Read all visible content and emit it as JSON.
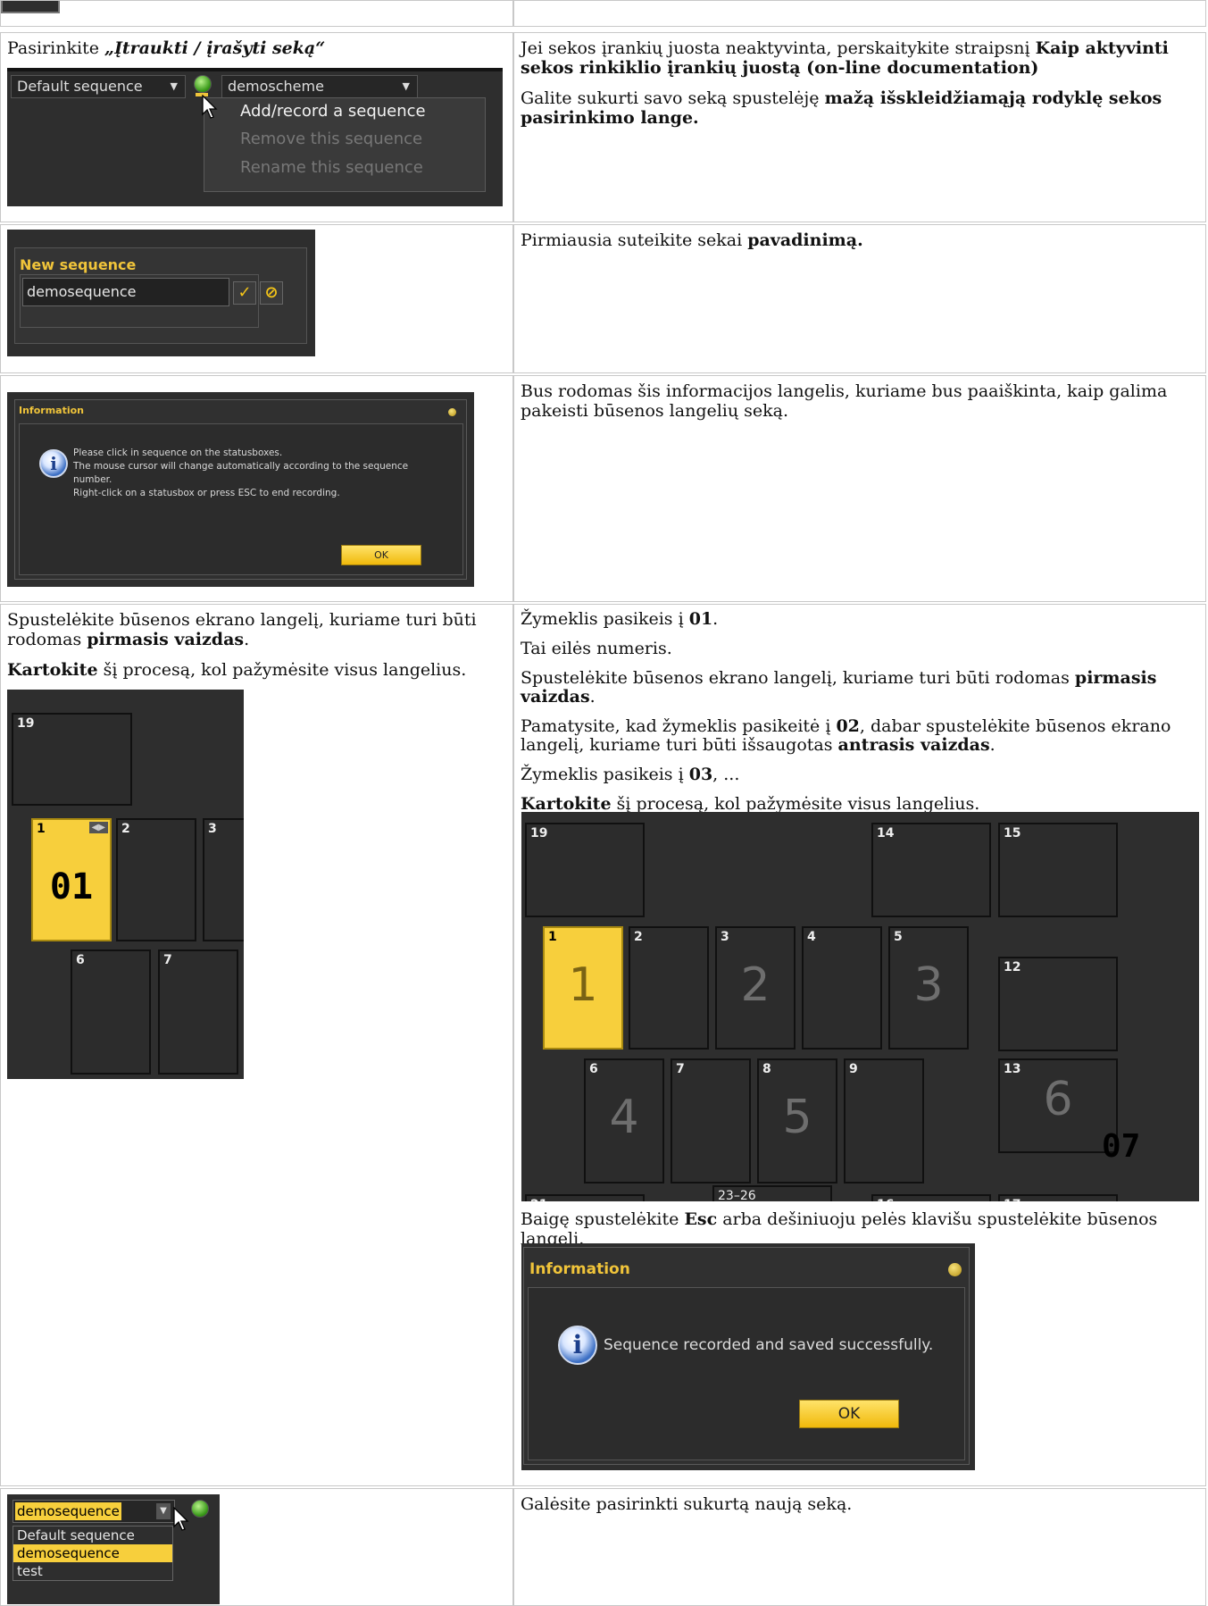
{
  "row1": {
    "left_text_prefix": "Pasirinkite ",
    "left_text_bold": "„Įtraukti / įrašyti seką“",
    "right_p1_prefix": "Jei sekos įrankių juosta neaktyvinta, perskaitykite straipsnį ",
    "right_p1_bold": "Kaip aktyvinti sekos rinkiklio įrankių juostą (on-line documentation)",
    "right_p2_prefix": "Galite sukurti savo seką spustelėję ",
    "right_p2_bold": "mažą išskleidžiamąją rodyklę sekos pasirinkimo lange.",
    "ui": {
      "sequence_dropdown": "Default sequence",
      "scheme_dropdown": "demoscheme",
      "menu_items": [
        "Add/record a sequence",
        "Remove this sequence",
        "Rename this sequence"
      ]
    }
  },
  "row2": {
    "right_prefix": "Pirmiausia suteikite sekai ",
    "right_bold": "pavadinimą.",
    "ui": {
      "title": "New sequence",
      "input_value": "demosequence"
    }
  },
  "row3": {
    "right_text": "Bus rodomas šis informacijos langelis, kuriame bus paaiškinta, kaip galima pakeisti būsenos langelių seką.",
    "ui": {
      "title": "Information",
      "lines": [
        "Please click in sequence on the statusboxes.",
        "The mouse cursor will change automatically according to the sequence",
        "number.",
        "Right-click on a statusbox or press ESC to end recording."
      ],
      "ok": "OK"
    }
  },
  "row4": {
    "left_p1_prefix": "Spustelėkite būsenos ekrano langelį, kuriame turi būti rodomas ",
    "left_p1_bold": "pirmasis vaizdas",
    "left_p1_suffix": ".",
    "left_p2_bold": "Kartokite",
    "left_p2_suffix": " šį procesą, kol pažymėsite visus langelius.",
    "left_ui": {
      "boxes": [
        "19",
        "1",
        "2",
        "3",
        "6",
        "7"
      ],
      "cursor_label": "01"
    },
    "right_p1_prefix": "Žymeklis pasikeis į ",
    "right_p1_bold": "01",
    "right_p1_suffix": ".",
    "right_p2": "Tai eilės numeris.",
    "right_p3_prefix": "Spustelėkite būsenos ekrano langelį, kuriame turi būti rodomas ",
    "right_p3_bold": "pirmasis vaizdas",
    "right_p3_suffix": ".",
    "right_p4_prefix": "Pamatysite, kad žymeklis pasikeitė į ",
    "right_p4_bold1": "02",
    "right_p4_mid": ", dabar spustelėkite būsenos ekrano langelį, kuriame turi būti išsaugotas ",
    "right_p4_bold2": "antrasis vaizdas",
    "right_p4_suffix": ".",
    "right_p5_prefix": "Žymeklis pasikeis į ",
    "right_p5_bold": "03",
    "right_p5_suffix": ", ...",
    "right_p6_bold": "Kartokite",
    "right_p6_suffix": " šį procesą, kol pažymėsite visus langelius.",
    "grid": {
      "boxes": [
        "19",
        "14",
        "15",
        "1",
        "2",
        "3",
        "4",
        "5",
        "12",
        "6",
        "7",
        "8",
        "9",
        "13",
        "21",
        "23–26",
        "16",
        "17"
      ],
      "seq_numbers": [
        "1",
        "2",
        "3",
        "4",
        "5",
        "6"
      ],
      "cursor_label": "07"
    },
    "right_p7_prefix": "Baigę spustelėkite ",
    "right_p7_bold": "Esc",
    "right_p7_suffix": " arba dešiniuoju pelės klavišu spustelėkite būsenos langelį.",
    "dialog": {
      "title": "Information",
      "message": "Sequence recorded and saved successfully.",
      "ok": "OK"
    }
  },
  "row5": {
    "right_text": "Galėsite pasirinkti sukurtą naują seką.",
    "ui": {
      "selected": "demosequence",
      "options": [
        "Default sequence",
        "demosequence",
        "test"
      ]
    }
  }
}
